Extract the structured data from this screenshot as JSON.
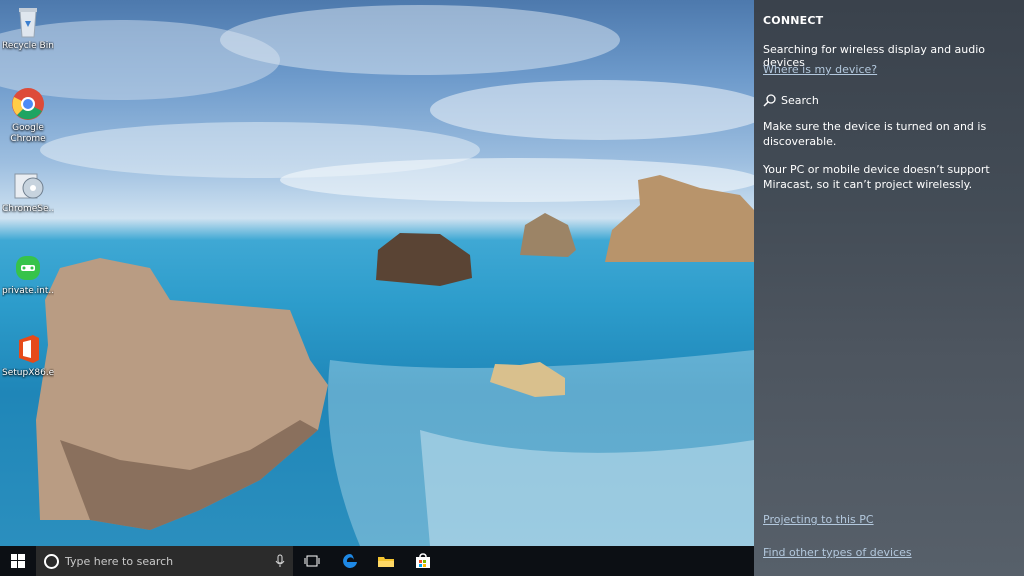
{
  "desktop": {
    "icons": [
      {
        "label": "Recycle Bin",
        "icon": "recycle-bin-icon"
      },
      {
        "label": "Google Chrome",
        "icon": "chrome-icon"
      },
      {
        "label": "ChromeSe...",
        "icon": "chrome-setup-icon"
      },
      {
        "label": "private.int...",
        "icon": "private-internet-access-icon"
      },
      {
        "label": "SetupX86.e...",
        "icon": "office-setup-icon"
      }
    ]
  },
  "taskbar": {
    "search_placeholder": "Type here to search",
    "items": [
      "start-icon",
      "cortana-icon",
      "microphone-icon",
      "task-view-icon",
      "edge-icon",
      "file-explorer-icon",
      "store-icon"
    ]
  },
  "connect_panel": {
    "title": "CONNECT",
    "searching": "Searching for wireless display and audio devices",
    "where_link": "Where is my device?",
    "search_label": "Search",
    "make_sure": "Make sure the device is turned on and is discoverable.",
    "miracast": "Your PC or mobile device doesn’t support Miracast, so it can’t project wirelessly.",
    "projecting_link": "Projecting to this PC",
    "find_other_link": "Find other types of devices"
  },
  "colors": {
    "taskbar": "#0c0f14",
    "panel": "#434c56",
    "link": "#b3c8dd"
  }
}
